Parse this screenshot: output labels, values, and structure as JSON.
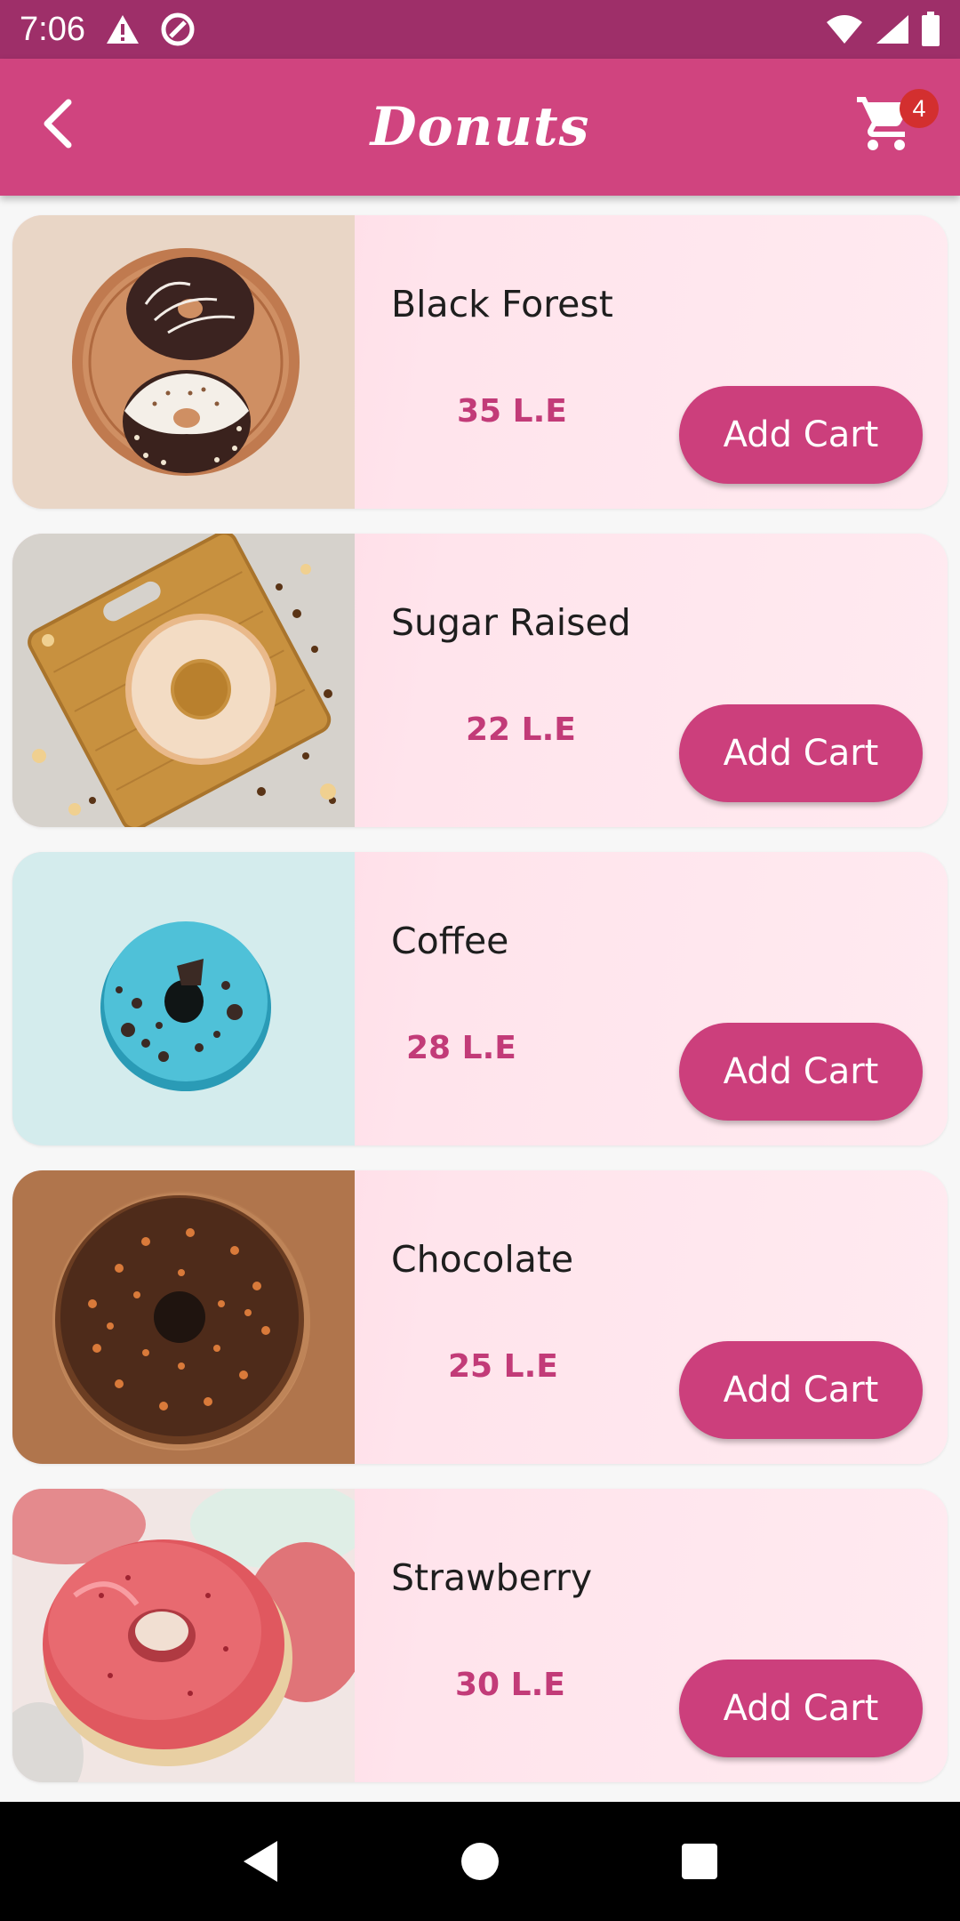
{
  "status_bar": {
    "time": "7:06",
    "icons": [
      "alert-triangle-icon",
      "at-sign-icon",
      "wifi-icon",
      "signal-icon",
      "battery-icon"
    ]
  },
  "app_bar": {
    "title": "Donuts",
    "back_icon": "chevron-left-icon",
    "cart_icon": "shopping-cart-icon",
    "cart_count": "4"
  },
  "products": [
    {
      "name": "Black Forest",
      "price": "35 L.E",
      "button": "Add Cart"
    },
    {
      "name": "Sugar Raised",
      "price": "22 L.E",
      "button": "Add Cart"
    },
    {
      "name": "Coffee",
      "price": "28 L.E",
      "button": "Add Cart"
    },
    {
      "name": "Chocolate",
      "price": "25 L.E",
      "button": "Add Cart"
    },
    {
      "name": "Strawberry",
      "price": "30 L.E",
      "button": "Add Cart"
    }
  ],
  "nav_bar": {
    "icons": [
      "back-triangle-icon",
      "home-circle-icon",
      "recents-square-icon"
    ]
  },
  "colors": {
    "status_bar": "#9e2f69",
    "app_bar": "#d0447f",
    "accent": "#cc3f7c",
    "price": "#c23b78",
    "badge": "#d32f2f"
  }
}
